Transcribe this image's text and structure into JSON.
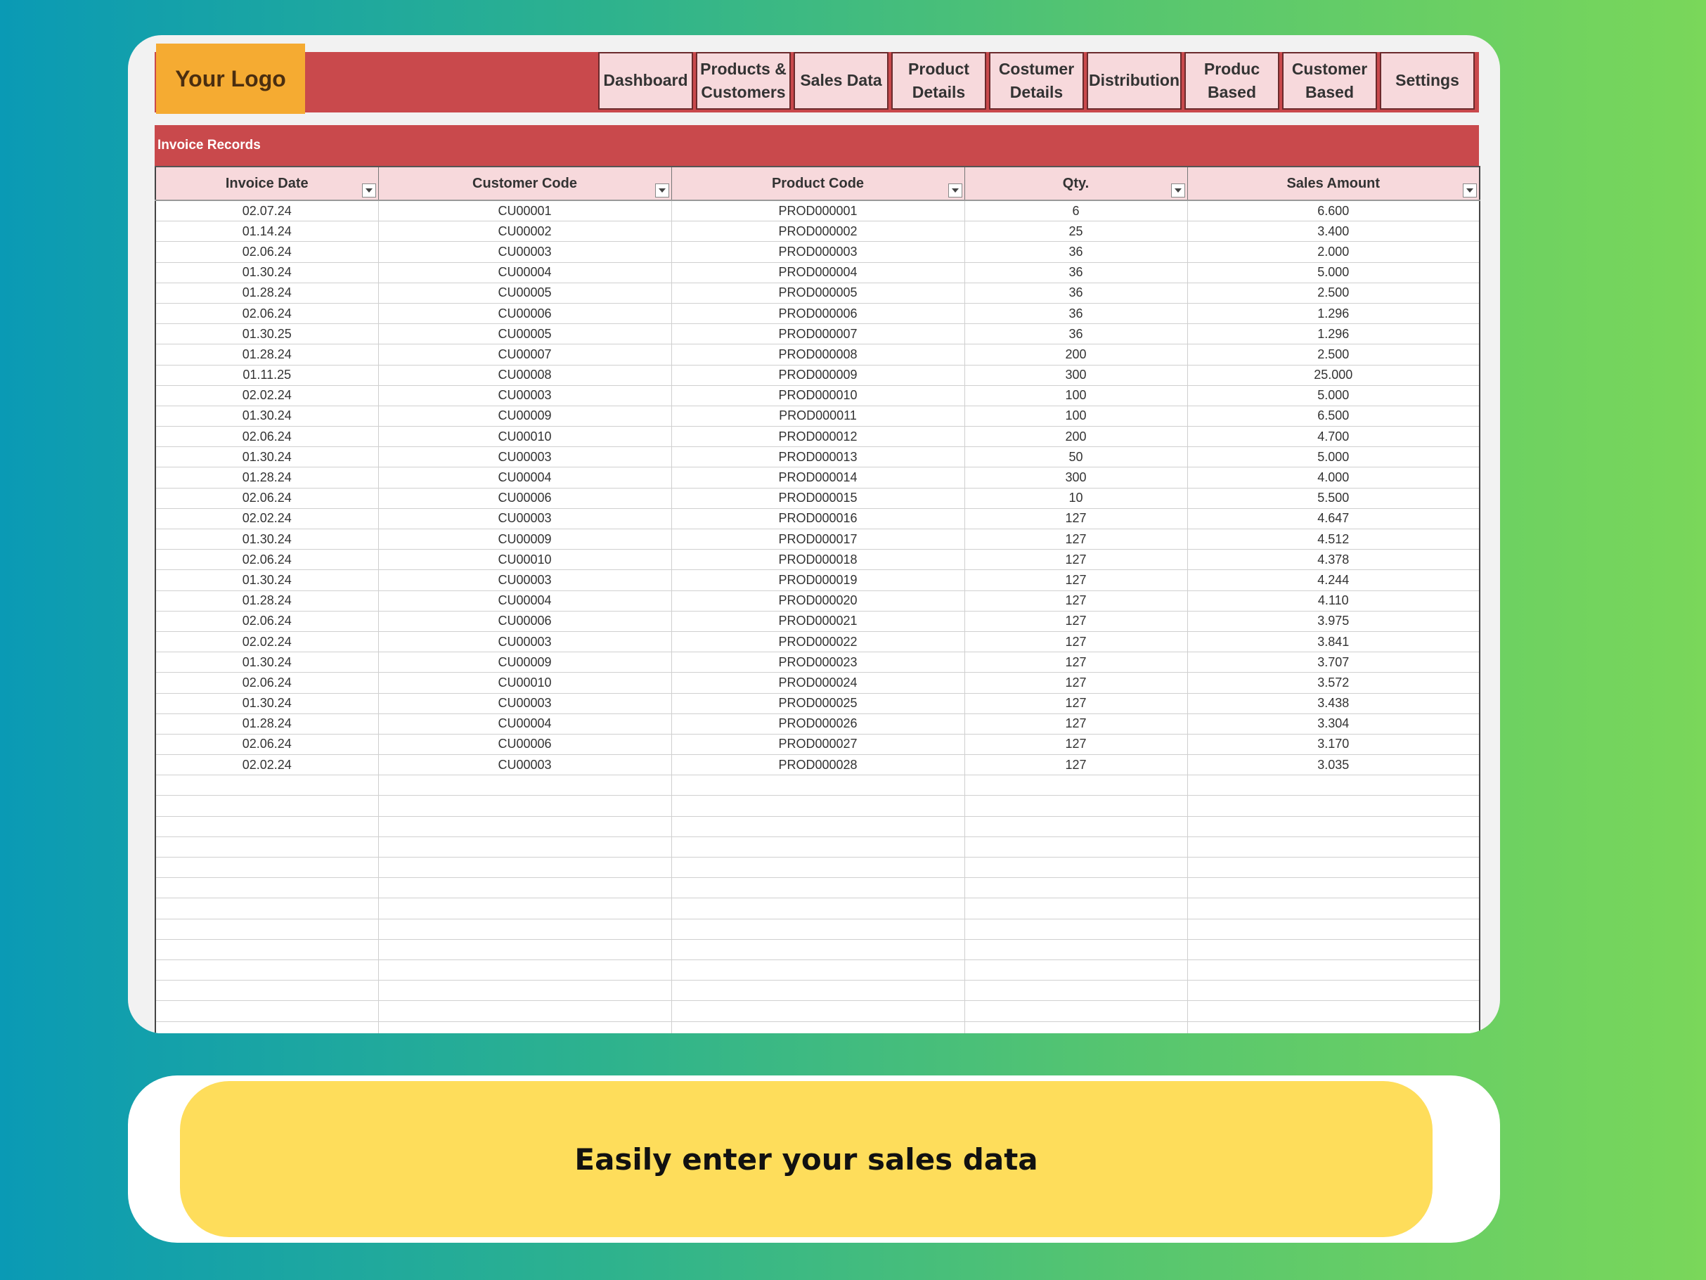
{
  "header": {
    "logo_text": "Your Logo",
    "nav": [
      {
        "label": "Dashboard"
      },
      {
        "label": "Products &\nCustomers"
      },
      {
        "label": "Sales Data"
      },
      {
        "label": "Product\nDetails"
      },
      {
        "label": "Costumer\nDetails"
      },
      {
        "label": "Distribution"
      },
      {
        "label": "Produc\nBased"
      },
      {
        "label": "Customer\nBased"
      },
      {
        "label": "Settings"
      }
    ]
  },
  "section": {
    "title": "Invoice Records"
  },
  "table": {
    "columns": [
      "Invoice Date",
      "Customer Code",
      "Product Code",
      "Qty.",
      "Sales Amount"
    ],
    "rows": [
      [
        "02.07.24",
        "CU00001",
        "PROD000001",
        "6",
        "6.600"
      ],
      [
        "01.14.24",
        "CU00002",
        "PROD000002",
        "25",
        "3.400"
      ],
      [
        "02.06.24",
        "CU00003",
        "PROD000003",
        "36",
        "2.000"
      ],
      [
        "01.30.24",
        "CU00004",
        "PROD000004",
        "36",
        "5.000"
      ],
      [
        "01.28.24",
        "CU00005",
        "PROD000005",
        "36",
        "2.500"
      ],
      [
        "02.06.24",
        "CU00006",
        "PROD000006",
        "36",
        "1.296"
      ],
      [
        "01.30.25",
        "CU00005",
        "PROD000007",
        "36",
        "1.296"
      ],
      [
        "01.28.24",
        "CU00007",
        "PROD000008",
        "200",
        "2.500"
      ],
      [
        "01.11.25",
        "CU00008",
        "PROD000009",
        "300",
        "25.000"
      ],
      [
        "02.02.24",
        "CU00003",
        "PROD000010",
        "100",
        "5.000"
      ],
      [
        "01.30.24",
        "CU00009",
        "PROD000011",
        "100",
        "6.500"
      ],
      [
        "02.06.24",
        "CU00010",
        "PROD000012",
        "200",
        "4.700"
      ],
      [
        "01.30.24",
        "CU00003",
        "PROD000013",
        "50",
        "5.000"
      ],
      [
        "01.28.24",
        "CU00004",
        "PROD000014",
        "300",
        "4.000"
      ],
      [
        "02.06.24",
        "CU00006",
        "PROD000015",
        "10",
        "5.500"
      ],
      [
        "02.02.24",
        "CU00003",
        "PROD000016",
        "127",
        "4.647"
      ],
      [
        "01.30.24",
        "CU00009",
        "PROD000017",
        "127",
        "4.512"
      ],
      [
        "02.06.24",
        "CU00010",
        "PROD000018",
        "127",
        "4.378"
      ],
      [
        "01.30.24",
        "CU00003",
        "PROD000019",
        "127",
        "4.244"
      ],
      [
        "01.28.24",
        "CU00004",
        "PROD000020",
        "127",
        "4.110"
      ],
      [
        "02.06.24",
        "CU00006",
        "PROD000021",
        "127",
        "3.975"
      ],
      [
        "02.02.24",
        "CU00003",
        "PROD000022",
        "127",
        "3.841"
      ],
      [
        "01.30.24",
        "CU00009",
        "PROD000023",
        "127",
        "3.707"
      ],
      [
        "02.06.24",
        "CU00010",
        "PROD000024",
        "127",
        "3.572"
      ],
      [
        "01.30.24",
        "CU00003",
        "PROD000025",
        "127",
        "3.438"
      ],
      [
        "01.28.24",
        "CU00004",
        "PROD000026",
        "127",
        "3.304"
      ],
      [
        "02.06.24",
        "CU00006",
        "PROD000027",
        "127",
        "3.170"
      ],
      [
        "02.02.24",
        "CU00003",
        "PROD000028",
        "127",
        "3.035"
      ]
    ]
  },
  "banner": {
    "text": "Easily enter your sales data"
  },
  "colors": {
    "header_red": "#c9494c",
    "logo_orange": "#f5ab32",
    "nav_pink": "#f7d9dc",
    "banner_yellow": "#fedd5b"
  }
}
